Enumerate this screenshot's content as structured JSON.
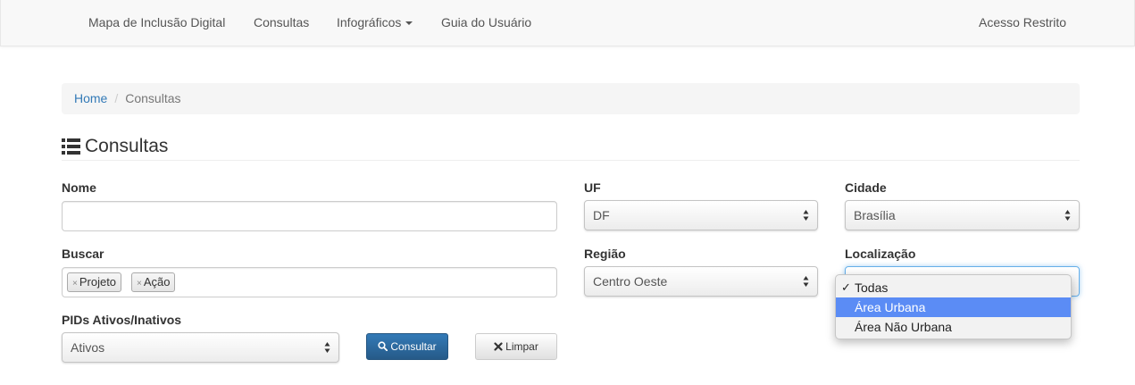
{
  "navbar": {
    "items": [
      {
        "label": "Mapa de Inclusão Digital"
      },
      {
        "label": "Consultas"
      },
      {
        "label": "Infográficos"
      },
      {
        "label": "Guia do Usuário"
      }
    ],
    "restricted_label": "Acesso Restrito"
  },
  "breadcrumb": {
    "home": "Home",
    "separator": "/",
    "current": "Consultas"
  },
  "page": {
    "title": "Consultas",
    "title_icon": "list-icon"
  },
  "form": {
    "nome": {
      "label": "Nome",
      "value": ""
    },
    "uf": {
      "label": "UF",
      "value": "DF"
    },
    "cidade": {
      "label": "Cidade",
      "value": "Brasília"
    },
    "buscar": {
      "label": "Buscar",
      "tags": [
        "Projeto",
        "Ação"
      ],
      "remove_symbol": "×"
    },
    "regiao": {
      "label": "Região",
      "value": "Centro Oeste"
    },
    "localizacao": {
      "label": "Localização",
      "options": [
        {
          "label": "Todas",
          "checked": true,
          "check_mark": "✓"
        },
        {
          "label": "Área Urbana",
          "highlighted": true
        },
        {
          "label": "Área Não Urbana"
        }
      ]
    },
    "pids": {
      "label": "PIDs Ativos/Inativos",
      "value": "Ativos"
    }
  },
  "buttons": {
    "consultar": {
      "label": "Consultar",
      "icon": "search-icon"
    },
    "limpar": {
      "label": "Limpar",
      "icon": "close-icon"
    }
  },
  "colors": {
    "primary": "#337ab7",
    "link": "#337ab7",
    "highlight": "#5b8cf5",
    "focus": "#66afe9"
  }
}
